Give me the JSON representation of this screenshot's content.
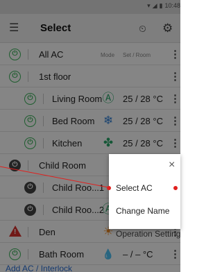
{
  "statusbar": {
    "time": "10:48",
    "wifi_icon": "wifi-icon",
    "signal_icon": "signal-icon",
    "battery_icon": "battery-icon"
  },
  "appbar": {
    "title": "Select",
    "menu_icon": "list-menu-icon",
    "timer_icon": "timer-icon",
    "settings_icon": "gear-icon"
  },
  "columns": {
    "mode": "Mode",
    "set_room": "Set / Room"
  },
  "rows": [
    {
      "name": "All AC",
      "power": "on",
      "mode": "",
      "temp": "",
      "more": "⋮"
    },
    {
      "name": "1st floor",
      "power": "on",
      "mode": "",
      "temp": "",
      "more": "⋮"
    },
    {
      "name": "Living Room",
      "power": "on",
      "mode": "Ⓐ",
      "mode_icon": "auto-mode-icon",
      "temp": "25 / 28 °C",
      "more": "⋮"
    },
    {
      "name": "Bed Room",
      "power": "on",
      "mode": "❄",
      "mode_icon": "snowflake-cool-icon",
      "temp": "25 / 28 °C",
      "more": "⋮"
    },
    {
      "name": "Kitchen",
      "power": "on",
      "mode": "✤",
      "mode_icon": "fan-icon",
      "temp": "25 / 28 °C",
      "more": "⋮"
    },
    {
      "name": "Child Room",
      "power": "off",
      "mode": "",
      "temp": "",
      "more": "⋮"
    },
    {
      "name": "Child Roo...1",
      "power": "off",
      "mode": "",
      "temp": "",
      "more": "⋮"
    },
    {
      "name": "Child Roo...2",
      "power": "off",
      "mode": "Ⓐ",
      "mode_icon": "auto-mode-icon",
      "temp": "",
      "more": "⋮"
    },
    {
      "name": "Den",
      "power": "warning",
      "mode": "☀",
      "mode_icon": "heat-sun-icon",
      "temp": "",
      "more": "⋮"
    },
    {
      "name": "Bath Room",
      "power": "on",
      "mode": "💧",
      "mode_icon": "dry-droplet-icon",
      "temp": "– / –  °C",
      "more": "⋮"
    }
  ],
  "footer": {
    "link": "Add AC / Interlock"
  },
  "popup": {
    "close": "×",
    "items": [
      "Select AC",
      "Change Name",
      "Operation Setting"
    ]
  },
  "colors": {
    "accent_green": "#3bb25a",
    "warning_red": "#d9302c",
    "callout_red": "#e0201e",
    "auto_mode": "#2aa76a",
    "cool_mode": "#2f7fd6",
    "fan_mode": "#2aa76a",
    "heat_mode": "#f08a24",
    "dry_mode": "#3a8fd8"
  }
}
